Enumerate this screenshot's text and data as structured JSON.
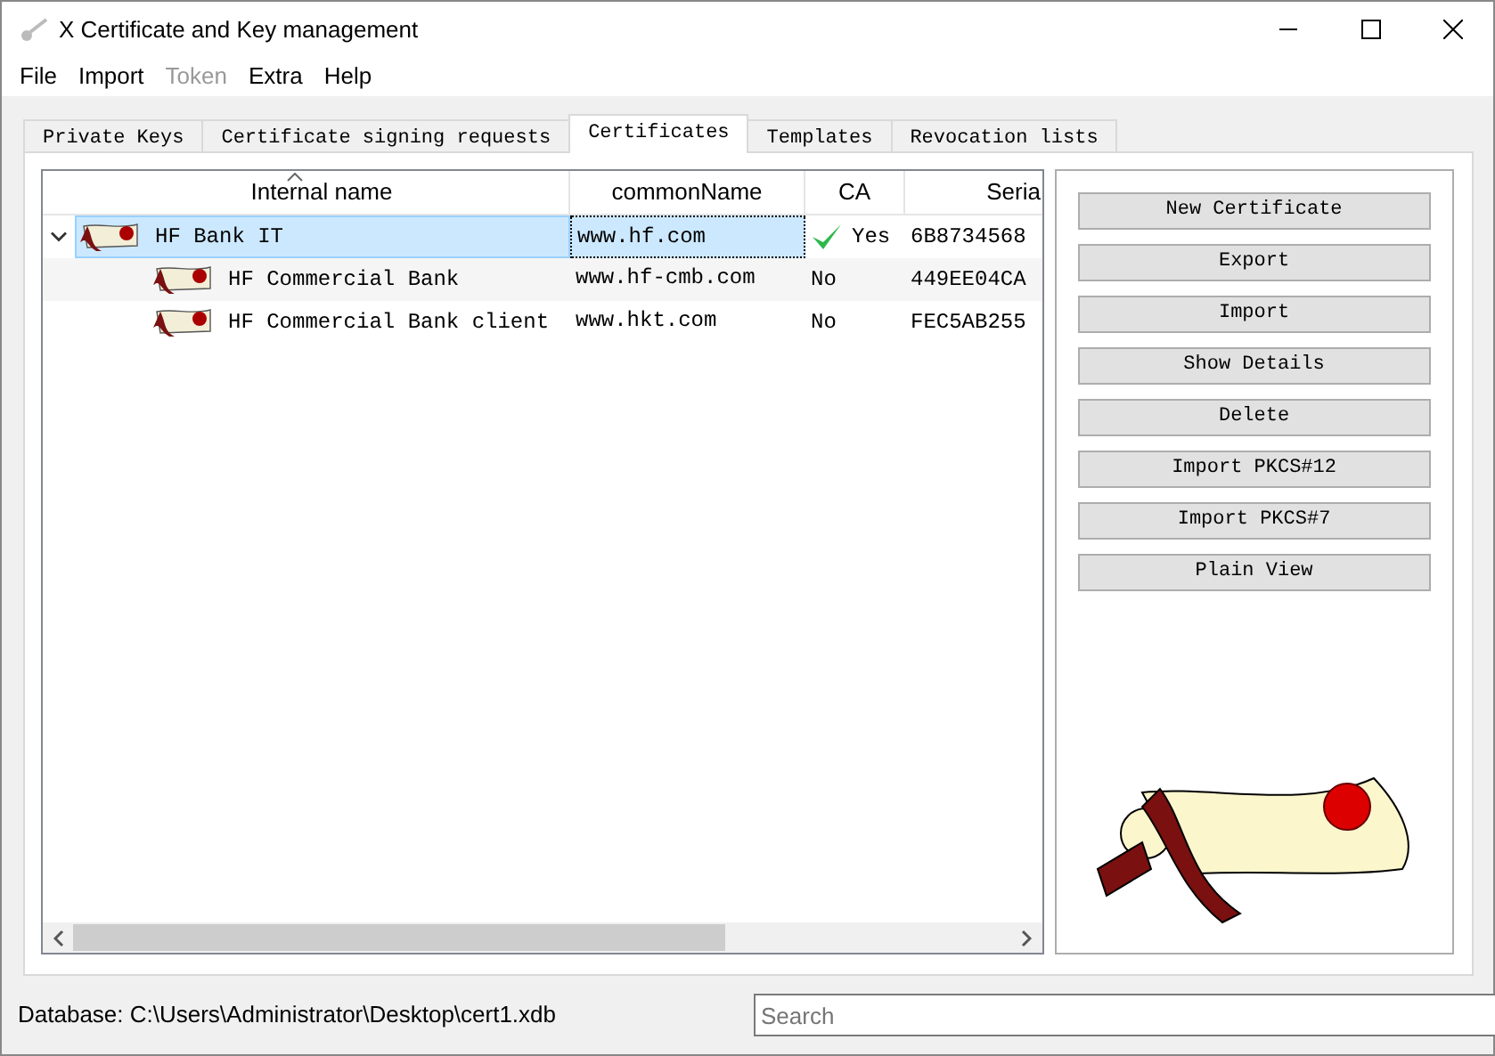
{
  "window": {
    "title": "X Certificate and Key management"
  },
  "menu": [
    {
      "label": "File",
      "disabled": false
    },
    {
      "label": "Import",
      "disabled": false
    },
    {
      "label": "Token",
      "disabled": true
    },
    {
      "label": "Extra",
      "disabled": false
    },
    {
      "label": "Help",
      "disabled": false
    }
  ],
  "tabs": [
    {
      "label": "Private Keys",
      "selected": false
    },
    {
      "label": "Certificate signing requests",
      "selected": false
    },
    {
      "label": "Certificates",
      "selected": true
    },
    {
      "label": "Templates",
      "selected": false
    },
    {
      "label": "Revocation lists",
      "selected": false
    }
  ],
  "table": {
    "columns": [
      "Internal name",
      "commonName",
      "CA",
      "Seria"
    ],
    "rows": [
      {
        "name": "HF Bank IT",
        "common_name": "www.hf.com",
        "ca": "Yes",
        "is_ca": true,
        "serial": "6B8734568",
        "expanded": true,
        "selected": true,
        "children": [
          {
            "name": "HF Commercial Bank",
            "common_name": "www.hf-cmb.com",
            "ca": "No",
            "is_ca": false,
            "serial": "449EE04CA",
            "selected": false
          },
          {
            "name": "HF Commercial Bank client",
            "common_name": "www.hkt.com",
            "ca": "No",
            "is_ca": false,
            "serial": "FEC5AB255",
            "selected": false
          }
        ]
      }
    ]
  },
  "buttons": [
    "New Certificate",
    "Export",
    "Import",
    "Show Details",
    "Delete",
    "Import PKCS#12",
    "Import PKCS#7",
    "Plain View"
  ],
  "status_bar": {
    "database": "Database: C:\\Users\\Administrator\\Desktop\\cert1.xdb",
    "search": {
      "placeholder": "Search"
    }
  }
}
